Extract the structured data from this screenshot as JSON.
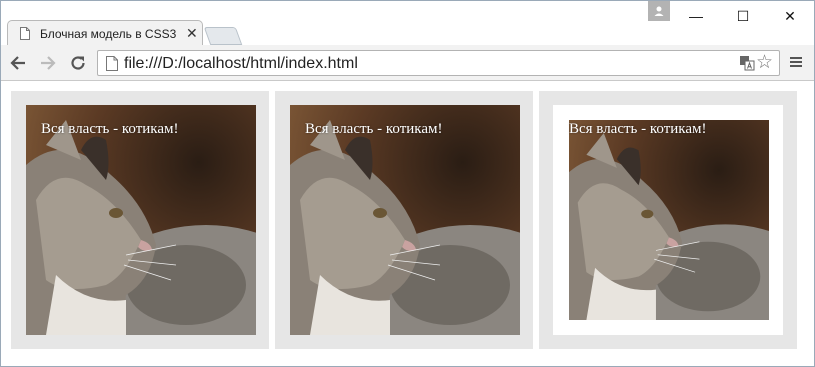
{
  "tab": {
    "title": "Блочная модель в CSS3",
    "close": "✕"
  },
  "window_controls": {
    "minimize": "—",
    "maximize": "☐",
    "close": "✕"
  },
  "toolbar": {
    "url": "file:///D:/localhost/html/index.html"
  },
  "boxes": [
    {
      "caption": "Вся власть - котикам!"
    },
    {
      "caption": "Вся власть - котикам!"
    },
    {
      "caption": "Вся власть - котикам!"
    }
  ],
  "colors": {
    "box_bg": "#e6e6e6",
    "caption": "#ffffff",
    "toolbar_bg": "#f2f2f2"
  }
}
